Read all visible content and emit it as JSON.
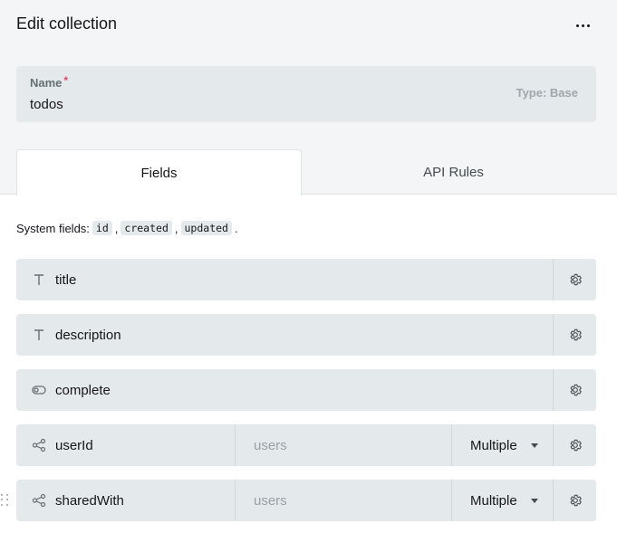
{
  "header": {
    "title": "Edit collection"
  },
  "name_field": {
    "label": "Name",
    "required_mark": "*",
    "value": "todos",
    "type_label": "Type: Base"
  },
  "tabs": [
    {
      "label": "Fields",
      "active": true
    },
    {
      "label": "API Rules",
      "active": false
    }
  ],
  "system_fields": {
    "prefix": "System fields:",
    "items": [
      "id",
      "created",
      "updated"
    ],
    "separator": ",",
    "suffix": "."
  },
  "fields": [
    {
      "name": "title",
      "icon": "text-icon"
    },
    {
      "name": "description",
      "icon": "text-icon"
    },
    {
      "name": "complete",
      "icon": "toggle-icon"
    },
    {
      "name": "userId",
      "icon": "relation-icon",
      "collection": "users",
      "mode": "Multiple"
    },
    {
      "name": "sharedWith",
      "icon": "relation-icon",
      "collection": "users",
      "mode": "Multiple"
    }
  ],
  "colors": {
    "top_background": "#f3f5f7",
    "field_background": "#e4e9ec",
    "required": "#e34562",
    "muted_text": "#a0a6ac"
  }
}
